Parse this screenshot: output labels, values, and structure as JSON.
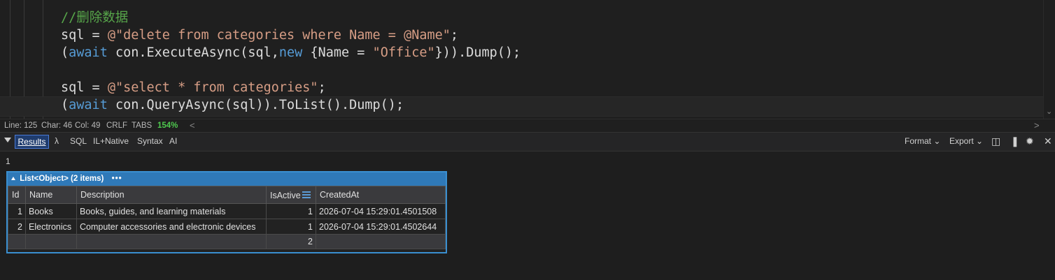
{
  "editor": {
    "lines": [
      [
        {
          "t": "//删除数据",
          "c": "com"
        }
      ],
      [
        {
          "t": "sql = ",
          "c": "def"
        },
        {
          "t": "@\"delete from categories where Name = @Name\"",
          "c": "str"
        },
        {
          "t": ";",
          "c": "def"
        }
      ],
      [
        {
          "t": "(",
          "c": "def"
        },
        {
          "t": "await",
          "c": "kw"
        },
        {
          "t": " con.ExecuteAsync(sql,",
          "c": "def"
        },
        {
          "t": "new",
          "c": "kw"
        },
        {
          "t": " {Name = ",
          "c": "def"
        },
        {
          "t": "\"Office\"",
          "c": "str"
        },
        {
          "t": "})).Dump();",
          "c": "def"
        }
      ],
      [
        {
          "t": "",
          "c": "def"
        }
      ],
      [
        {
          "t": "sql = ",
          "c": "def"
        },
        {
          "t": "@\"select * from categories\"",
          "c": "str"
        },
        {
          "t": ";",
          "c": "def"
        }
      ],
      [
        {
          "t": "(",
          "c": "def"
        },
        {
          "t": "await",
          "c": "kw"
        },
        {
          "t": " con.QueryAsync(sql)).ToList().Dump();",
          "c": "def"
        }
      ]
    ]
  },
  "status": {
    "line": "Line: 125",
    "char": "Char: 46",
    "col": "Col: 49",
    "eol": "CRLF",
    "indent": "TABS",
    "zoom": "154%",
    "scroll_left": "<",
    "scroll_right": ">"
  },
  "toolbar": {
    "results": "Results",
    "lambda": "λ",
    "sql": "SQL",
    "il": "IL+Native",
    "syntax": "Syntax",
    "ai": "AI",
    "format": "Format ⌄",
    "export": "Export ⌄",
    "icons": [
      "split-panel-icon",
      "pin-icon",
      "spinner-icon",
      "close-icon"
    ]
  },
  "output": {
    "first_value": "1"
  },
  "dump": {
    "title": "List<Object> (2 items)",
    "menu": "•••",
    "columns": [
      "Id",
      "Name",
      "Description",
      "IsActive",
      "CreatedAt"
    ],
    "rows": [
      [
        "1",
        "Books",
        "Books, guides, and learning materials",
        "1",
        "2026-07-04 15:29:01.4501508"
      ],
      [
        "2",
        "Electronics",
        "Computer accessories and electronic devices",
        "1",
        "2026-07-04 15:29:01.4502644"
      ]
    ],
    "summary": [
      "",
      "",
      "",
      "2",
      ""
    ]
  },
  "colors": {
    "comment": "#57a64a",
    "string": "#d69d85",
    "keyword": "#569cd6",
    "zoom": "#4ec94e",
    "dump_header": "#2f79b8"
  }
}
